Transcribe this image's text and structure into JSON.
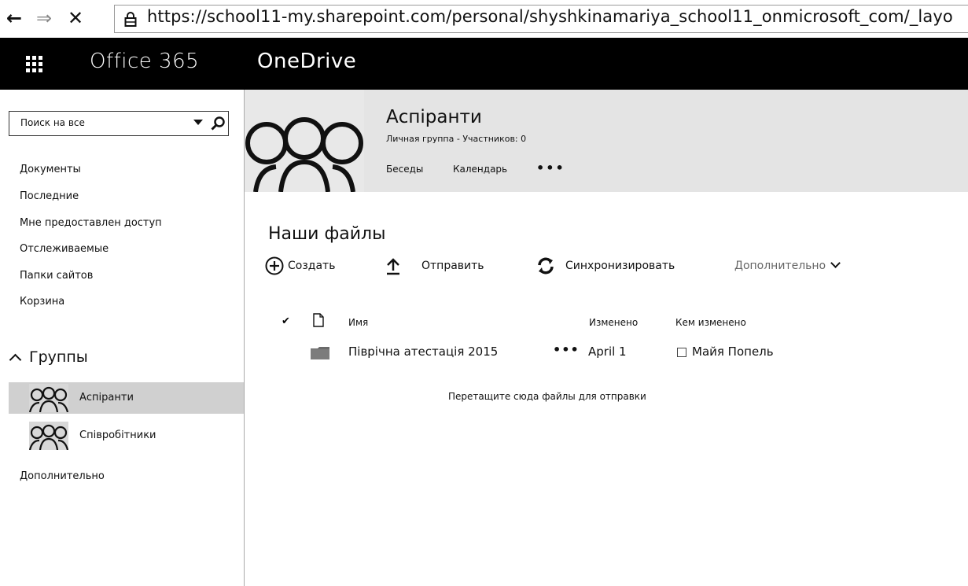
{
  "browser": {
    "url": "https://school11-my.sharepoint.com/personal/shyshkinamariya_school11_onmicrosoft_com/_layo"
  },
  "suite": {
    "brand": "Office 365",
    "app": "OneDrive"
  },
  "search": {
    "placeholder": "Поиск на все"
  },
  "nav": {
    "items": [
      {
        "label": "Документы"
      },
      {
        "label": "Последние"
      },
      {
        "label": "Мне предоставлен доступ"
      },
      {
        "label": "Отслеживаемые"
      },
      {
        "label": "Папки сайтов"
      },
      {
        "label": "Корзина"
      }
    ],
    "groups_header": "Группы",
    "groups": [
      {
        "label": "Аспіранти",
        "selected": true
      },
      {
        "label": "Співробітники",
        "selected": false
      }
    ],
    "more": "Дополнительно"
  },
  "group": {
    "title": "Аспіранти",
    "subtitle": "Личная группа - Участников: 0",
    "tabs": [
      {
        "label": "Беседы"
      },
      {
        "label": "Календарь"
      }
    ],
    "more": "•••"
  },
  "files": {
    "title": "Наши файлы",
    "commands": {
      "create": "Создать",
      "upload": "Отправить",
      "sync": "Синхронизировать",
      "more": "Дополнительно"
    },
    "columns": {
      "check": "✔",
      "name": "Имя",
      "modified": "Изменено",
      "modified_by": "Кем изменено"
    },
    "rows": [
      {
        "name": "Піврічна атестація 2015",
        "menu": "•••",
        "modified": "April 1",
        "modified_by": "Майя Попель"
      }
    ],
    "drop_hint": "Перетащите сюда файлы для отправки"
  },
  "colors": {
    "suite_bar": "#000000",
    "selected_nav": "#d0d0d0",
    "group_header_bg": "#e4e4e4"
  }
}
